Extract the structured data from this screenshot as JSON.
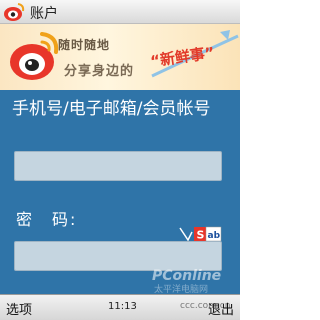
{
  "window": {
    "title": "账户",
    "logo_icon": "weibo-eye-icon"
  },
  "banner": {
    "line1": "随时随地",
    "line2": "分享身边的",
    "slogan": "“新鲜事”",
    "logo_icon": "weibo-eye-icon"
  },
  "form": {
    "account_label": "手机号/电子邮箱/会员帐号",
    "account_value": "",
    "password_label": "密　码:",
    "password_value": "",
    "ime_icon": "sogou-ime-icon",
    "ime_text": "ab"
  },
  "watermark": {
    "text": "PConline",
    "sub": "太平洋电脑网"
  },
  "softkeys": {
    "left": "选项",
    "right": "退出",
    "clock": "11:13",
    "extra": "ccc.com.cn"
  },
  "colors": {
    "form_bg": "#2f74a8",
    "input_bg": "#c5d5e0",
    "slogan": "#e23a2a"
  }
}
